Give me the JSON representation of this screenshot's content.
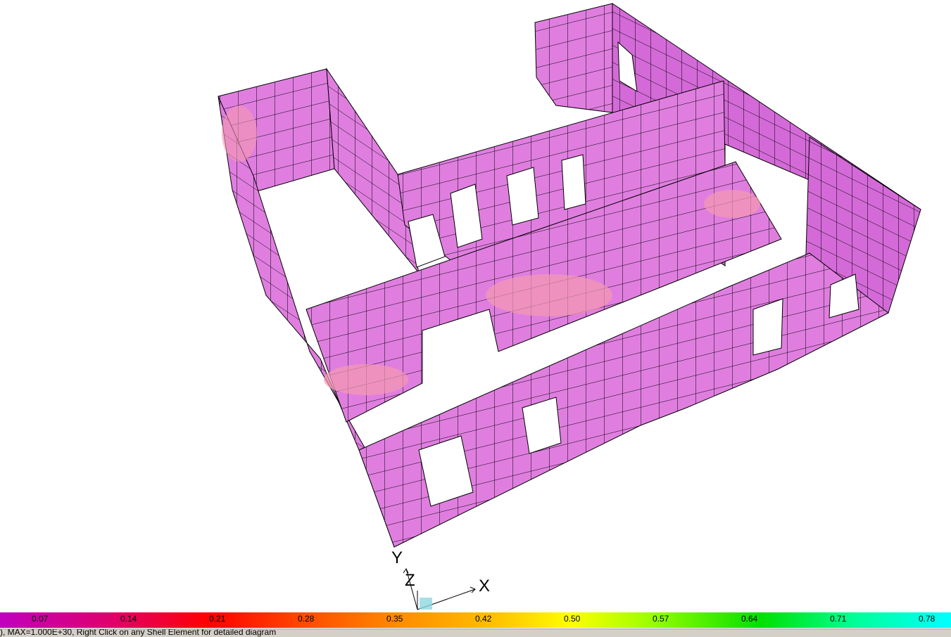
{
  "legend": {
    "ticks": [
      "0.07",
      "0.14",
      "0.21",
      "0.28",
      "0.35",
      "0.42",
      "0.50",
      "0.57",
      "0.64",
      "0.71",
      "0.78"
    ]
  },
  "axes": {
    "x": "X",
    "y": "Y",
    "z": "Z"
  },
  "status": {
    "text": "), MAX=1.000E+30, Right Click on any Shell Element for detailed diagram"
  },
  "colors": {
    "shell": "#e07ee0",
    "hot": "#f49ab0",
    "mesh": "#000000"
  }
}
